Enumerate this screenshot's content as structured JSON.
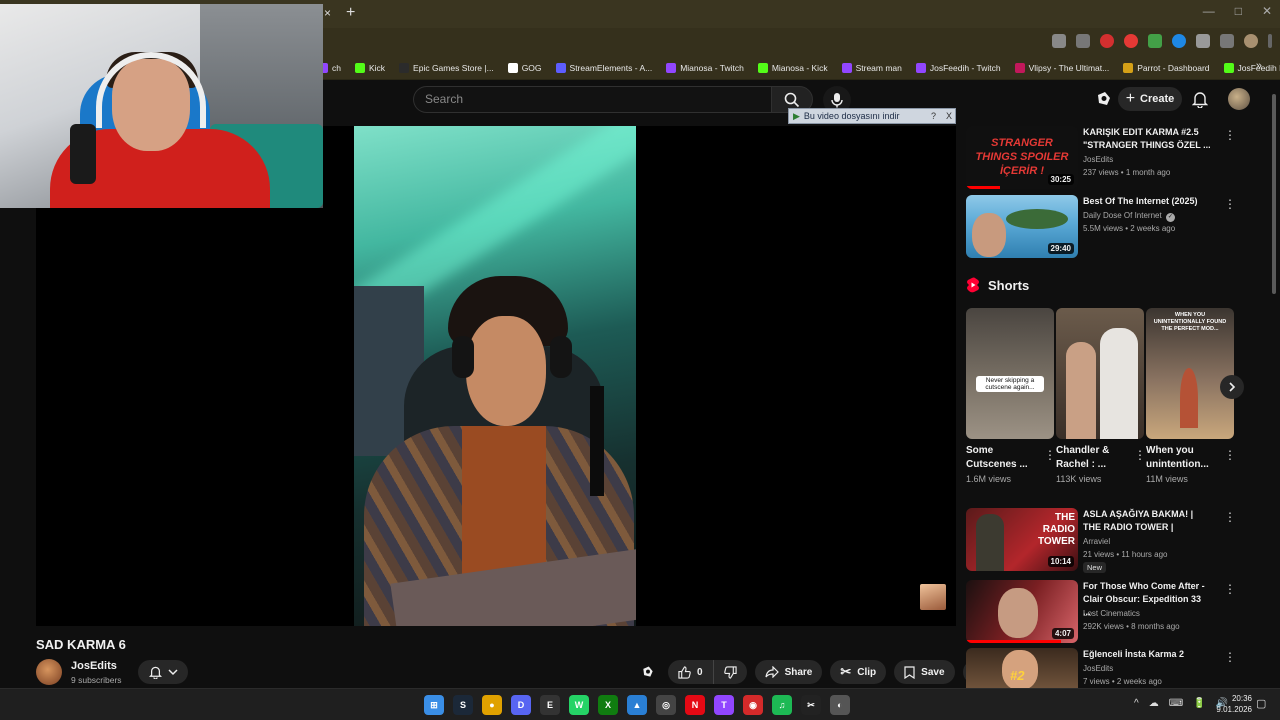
{
  "browser": {
    "tab_close": "×",
    "tab_new": "+",
    "window_controls": [
      "—",
      "□",
      "✕"
    ],
    "bookmarks": [
      {
        "label": "ch",
        "color": "#9146ff"
      },
      {
        "label": "Kick",
        "color": "#53fc18"
      },
      {
        "label": "Epic Games Store |...",
        "color": "#2b2b2b"
      },
      {
        "label": "GOG",
        "color": "#ffffff"
      },
      {
        "label": "StreamElements - A...",
        "color": "#5d5dff"
      },
      {
        "label": "Mianosa - Twitch",
        "color": "#9146ff"
      },
      {
        "label": "Mianosa - Kick",
        "color": "#53fc18"
      },
      {
        "label": "Stream man",
        "color": "#9146ff"
      },
      {
        "label": "JosFeedih - Twitch",
        "color": "#9146ff"
      },
      {
        "label": "Vlipsy - The Ultimat...",
        "color": "#c2185b"
      },
      {
        "label": "Parrot - Dashboard",
        "color": "#d4a017"
      },
      {
        "label": "JosFeedih Kick",
        "color": "#53fc18"
      }
    ],
    "bookmarks_more": "»"
  },
  "youtube": {
    "search_placeholder": "Search",
    "create_label": "Create",
    "download_banner": {
      "label": "Bu video dosyasını indir",
      "help": "?",
      "close": "X"
    },
    "video": {
      "title": "SAD KARMA 6",
      "channel": "JosEdits",
      "subscribers": "9 subscribers",
      "likes": "0",
      "share_label": "Share",
      "clip_label": "Clip",
      "save_label": "Save",
      "more": "•••"
    },
    "recommendations_top": [
      {
        "title": "KARIŞIK EDIT KARMA #2.5 \"STRANGER THINGS ÖZEL ...",
        "channel": "JosEdits",
        "meta": "237 views • 1 month ago",
        "duration": "30:25",
        "thumb_text": "STRANGER THINGS SPOILER İÇERİR !",
        "progress_percent": 30
      },
      {
        "title": "Best Of The Internet (2025)",
        "channel": "Daily Dose Of Internet",
        "verified": "✓",
        "meta": "5.5M views • 2 weeks ago",
        "duration": "29:40"
      }
    ],
    "shorts": {
      "heading": "Shorts",
      "items": [
        {
          "title": "Some Cutscenes ...",
          "views": "1.6M views",
          "overlay": "Never skipping a cutscene again..."
        },
        {
          "title": "Chandler & Rachel : ...",
          "views": "113K views",
          "overlay": ""
        },
        {
          "title": "When you unintention...",
          "views": "11M views",
          "overlay": "WHEN YOU UNINTENTIONALLY FOUND THE PERFECT MOD..."
        }
      ]
    },
    "recommendations_bottom": [
      {
        "title": "ASLA AŞAĞIYA BAKMA! | THE RADIO TOWER |",
        "channel": "Arraviel",
        "meta": "21 views • 11 hours ago",
        "badge": "New",
        "duration": "10:14",
        "thumb_text": "THE RADIO TOWER"
      },
      {
        "title": "For Those Who Come After - Clair Obscur: Expedition 33 ...",
        "channel": "Lost Cinematics",
        "meta": "292K views • 8 months ago",
        "duration": "4:07",
        "progress_percent": 85
      },
      {
        "title": "Eğlenceli İnsta Karma 2",
        "channel": "JosEdits",
        "meta": "7 views • 2 weeks ago",
        "thumb_text": "#2"
      }
    ],
    "kebab": "⋮"
  },
  "taskbar": {
    "apps": [
      {
        "name": "windows",
        "glyph": "⊞",
        "color": "#3a8ee6"
      },
      {
        "name": "steam",
        "glyph": "S",
        "color": "#1b2838"
      },
      {
        "name": "chrome",
        "glyph": "●",
        "color": "#e0a100"
      },
      {
        "name": "discord",
        "glyph": "D",
        "color": "#5865f2"
      },
      {
        "name": "epic",
        "glyph": "E",
        "color": "#333333"
      },
      {
        "name": "whatsapp",
        "glyph": "W",
        "color": "#25d366"
      },
      {
        "name": "xbox",
        "glyph": "X",
        "color": "#107c10"
      },
      {
        "name": "photos",
        "glyph": "▲",
        "color": "#2a7fd4"
      },
      {
        "name": "obs",
        "glyph": "◎",
        "color": "#444444"
      },
      {
        "name": "netflix",
        "glyph": "N",
        "color": "#e50914"
      },
      {
        "name": "twitch",
        "glyph": "T",
        "color": "#9146ff"
      },
      {
        "name": "app-red",
        "glyph": "◉",
        "color": "#d42a2a"
      },
      {
        "name": "spotify",
        "glyph": "♫",
        "color": "#1db954"
      },
      {
        "name": "capcut",
        "glyph": "✂",
        "color": "#222222"
      },
      {
        "name": "recorder",
        "glyph": "◐",
        "color": "#555555"
      }
    ],
    "tray": [
      "^",
      "☁",
      "⌨",
      "🔋",
      "🔊"
    ],
    "time": "20:36",
    "date": "9.01.2026"
  }
}
